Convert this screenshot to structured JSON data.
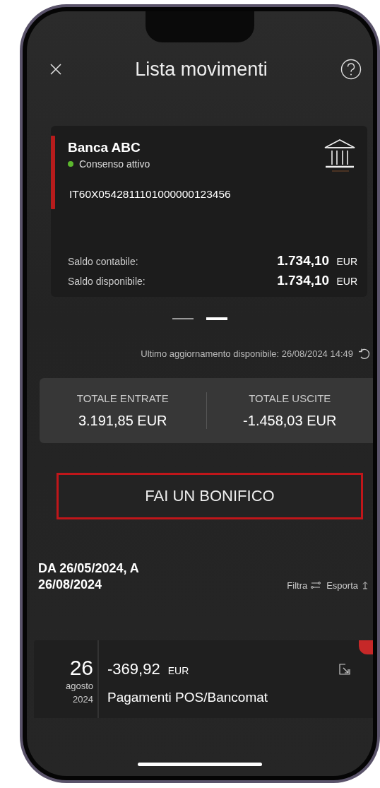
{
  "header": {
    "title": "Lista movimenti"
  },
  "account": {
    "bank": "Banca ABC",
    "consent": {
      "label": "Consenso attivo",
      "active": true
    },
    "iban": "IT60X0542811101000000123456",
    "balances": [
      {
        "label": "Saldo contabile:",
        "amount": "1.734,10",
        "currency": "EUR"
      },
      {
        "label": "Saldo disponibile:",
        "amount": "1.734,10",
        "currency": "EUR"
      }
    ]
  },
  "pager": [
    {
      "selected": false
    },
    {
      "selected": true
    }
  ],
  "last_update": "Ultimo aggiornamento disponibile: 26/08/2024 14:49",
  "totals": [
    {
      "label": "TOTALE ENTRATE",
      "value": "3.191,85 EUR"
    },
    {
      "label": "TOTALE USCITE",
      "value": "-1.458,03 EUR"
    }
  ],
  "transfer_button": "FAI UN BONIFICO",
  "period": "DA 26/05/2024, A 26/08/2024",
  "actions": [
    {
      "label": "Filtra",
      "kind": "filter"
    },
    {
      "label": "Esporta",
      "kind": "export"
    }
  ],
  "movements": [
    {
      "day": "26",
      "month": "agosto",
      "year": "2024",
      "amount": "-369,92",
      "currency": "EUR",
      "description": "Pagamenti POS/Bancomat",
      "unread": true
    }
  ]
}
